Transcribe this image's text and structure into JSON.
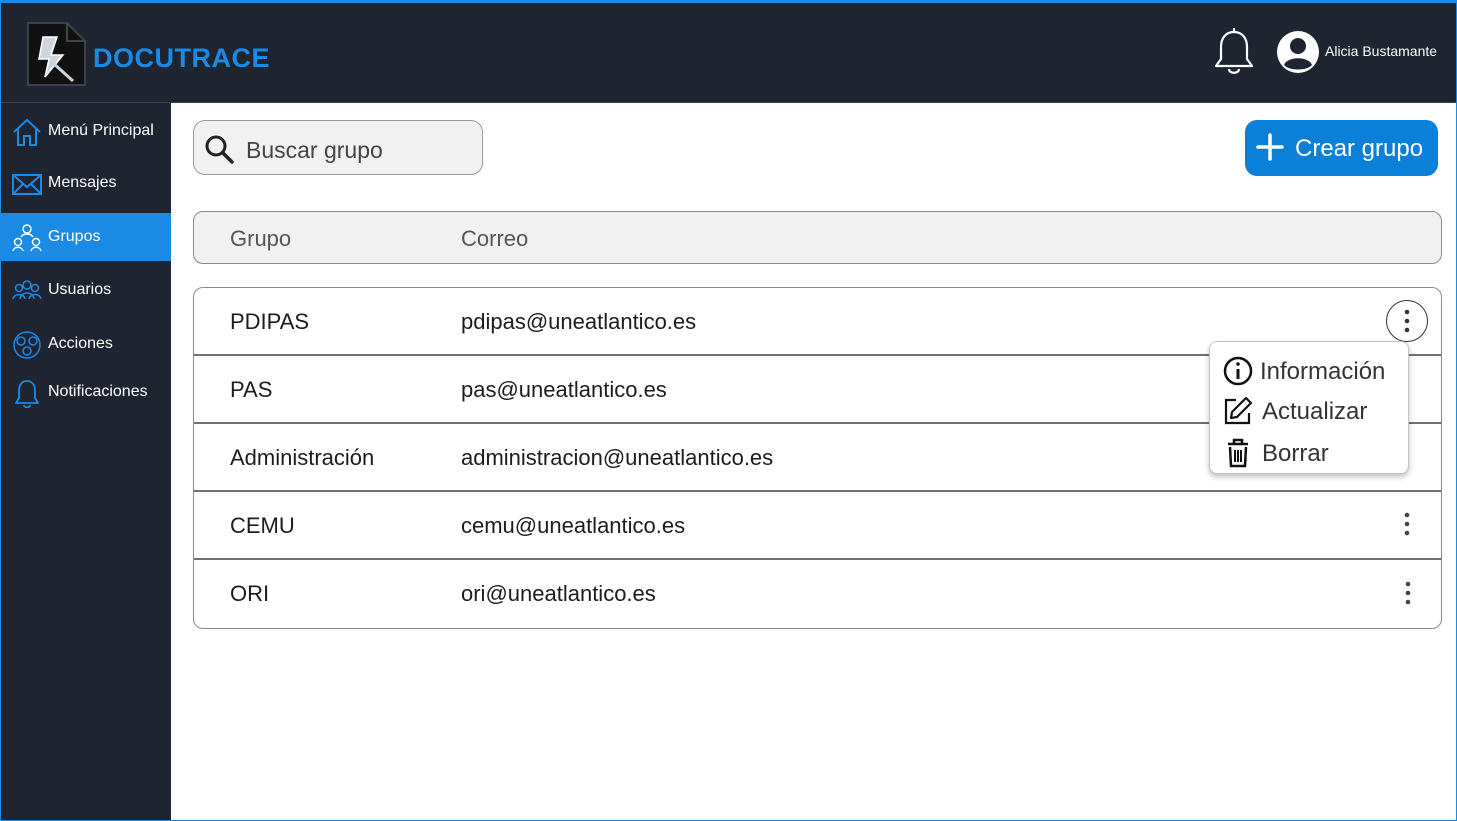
{
  "app": {
    "brand": "DOCUTRACE",
    "username": "Alicia Bustamante",
    "accent_color": "#1a8ae5",
    "bar_color": "#1e2430"
  },
  "sidebar": {
    "items": [
      {
        "label": "Menú Principal",
        "icon": "home-icon",
        "active": false
      },
      {
        "label": "Mensajes",
        "icon": "envelope-icon",
        "active": false
      },
      {
        "label": "Grupos",
        "icon": "groups-icon",
        "active": true
      },
      {
        "label": "Usuarios",
        "icon": "users-icon",
        "active": false
      },
      {
        "label": "Acciones",
        "icon": "actions-icon",
        "active": false
      },
      {
        "label": "Notificaciones",
        "icon": "bell-icon",
        "active": false
      }
    ]
  },
  "toolbar": {
    "search_placeholder": "Buscar grupo",
    "create_label": "Crear grupo"
  },
  "table": {
    "columns": [
      "Grupo",
      "Correo"
    ],
    "rows": [
      {
        "grupo": "PDIPAS",
        "correo": "pdipas@uneatlantico.es"
      },
      {
        "grupo": "PAS",
        "correo": "pas@uneatlantico.es"
      },
      {
        "grupo": "Administración",
        "correo": "administracion@uneatlantico.es"
      },
      {
        "grupo": "CEMU",
        "correo": "cemu@uneatlantico.es"
      },
      {
        "grupo": "ORI",
        "correo": "ori@uneatlantico.es"
      }
    ]
  },
  "context_menu": {
    "items": [
      {
        "label": "Información",
        "icon": "info-icon"
      },
      {
        "label": "Actualizar",
        "icon": "edit-icon"
      },
      {
        "label": "Borrar",
        "icon": "trash-icon"
      }
    ]
  }
}
